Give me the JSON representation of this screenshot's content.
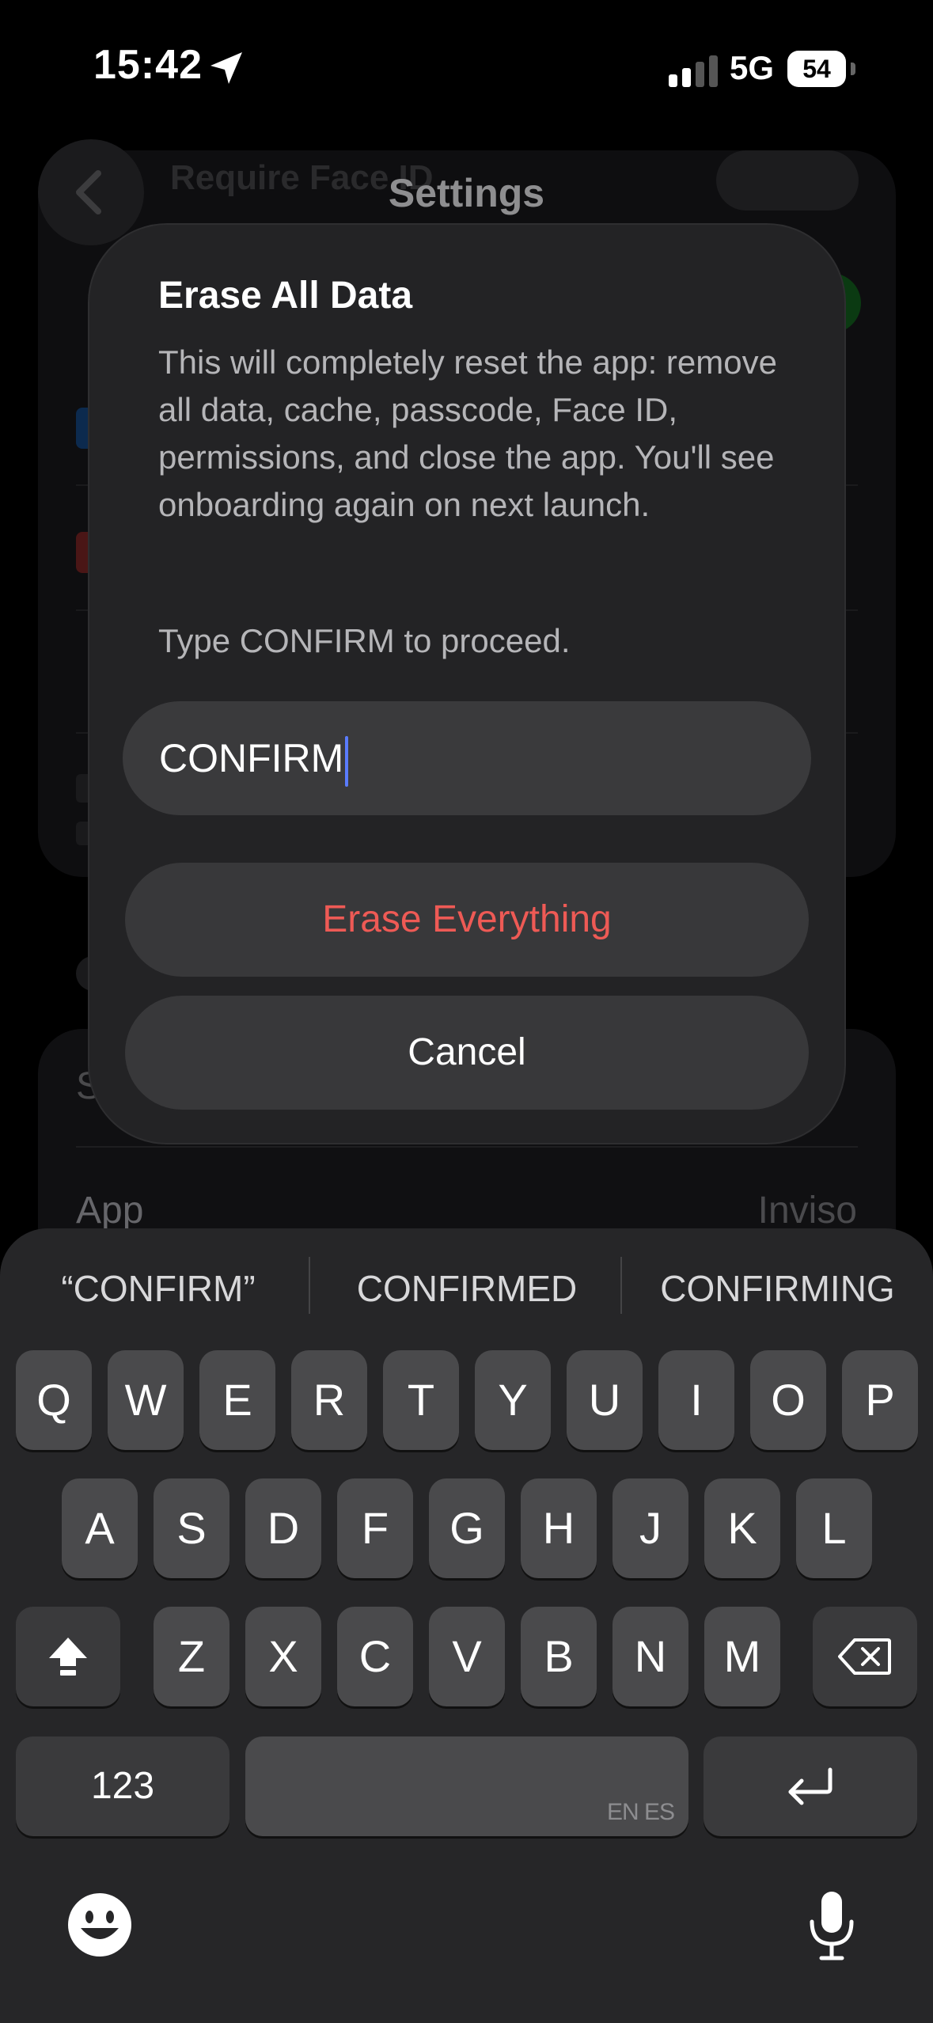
{
  "status_bar": {
    "time": "15:42",
    "network": "5G",
    "battery_level": "54"
  },
  "background": {
    "header_title": "Settings",
    "blur_row_text": "Require Face ID",
    "row_s": "S",
    "row_app_label": "App",
    "row_app_value": "Inviso"
  },
  "alert": {
    "title": "Erase All Data",
    "message": "This will completely reset the app: remove all data, cache, passcode, Face ID, permissions, and close the app. You'll see onboarding again on next launch.",
    "instruction": "Type CONFIRM to proceed.",
    "input_value": "CONFIRM",
    "erase_label": "Erase Everything",
    "cancel_label": "Cancel"
  },
  "keyboard": {
    "suggestions": [
      "“CONFIRM”",
      "CONFIRMED",
      "CONFIRMING"
    ],
    "row1": [
      "Q",
      "W",
      "E",
      "R",
      "T",
      "Y",
      "U",
      "I",
      "O",
      "P"
    ],
    "row2": [
      "A",
      "S",
      "D",
      "F",
      "G",
      "H",
      "J",
      "K",
      "L"
    ],
    "row3": [
      "Z",
      "X",
      "C",
      "V",
      "B",
      "N",
      "M"
    ],
    "numbers_label": "123",
    "space_languages": "EN ES"
  },
  "colors": {
    "destructive": "#ee5a55",
    "cursor": "#5a7cff",
    "key": "#4a4a4c"
  },
  "icons": [
    "location-arrow-icon",
    "cell-signal-icon",
    "battery-icon",
    "back-chevron-icon",
    "shift-icon",
    "backspace-icon",
    "return-icon",
    "emoji-icon",
    "microphone-icon"
  ]
}
